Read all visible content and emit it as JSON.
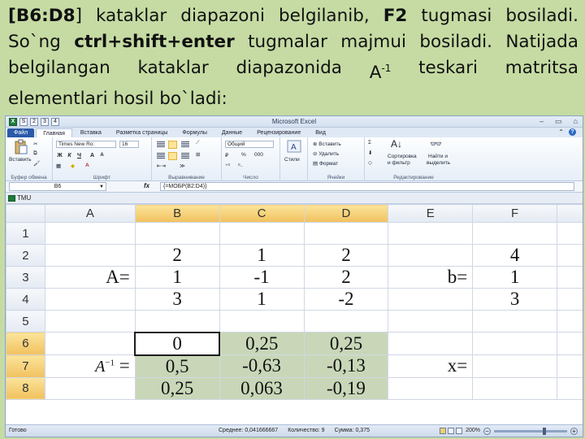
{
  "slide": {
    "line1": {
      "w1": "[B6:D8",
      "w1b": "]",
      "w2": "kataklar",
      "w3": "diapazoni",
      "w4": "belgilanib,",
      "w5": "F2",
      "w6": "tugmasi",
      "w7": "bosiladi."
    },
    "line2": {
      "w1": "So`ng",
      "w2": "ctrl+shift+enter",
      "w3": "tugmalar",
      "w4": "majmui",
      "w5": "bosiladi.",
      "w6": "Natijada"
    },
    "line3": {
      "w1": "belgilangan",
      "w2": "kataklar",
      "w3": "diapazonida",
      "w4a": "A",
      "w4sup": "-1",
      "w5": "teskari",
      "w6": "matritsa"
    },
    "line4": "elementlari hosil bo`ladi:"
  },
  "excel": {
    "title": "Microsoft Excel",
    "qat": [
      "X",
      "S",
      "2",
      "3",
      "4"
    ],
    "window_buttons": [
      "–",
      "▭",
      "⌂"
    ],
    "tabs": [
      {
        "label": "Файл",
        "key": ""
      },
      {
        "label": "Главная",
        "key": "Я"
      },
      {
        "label": "Вставка",
        "key": "С"
      },
      {
        "label": "Разметка страницы",
        "key": "З"
      },
      {
        "label": "Формулы",
        "key": "Л"
      },
      {
        "label": "Данные",
        "key": "Ы"
      },
      {
        "label": "Рецензирование",
        "key": "Р"
      },
      {
        "label": "Вид",
        "key": "О"
      }
    ],
    "ribbon": {
      "clipboard": {
        "paste": "Вставить",
        "label": "Буфер обмена"
      },
      "font": {
        "name": "Times New Ro:",
        "size": "16",
        "bold": "Ж",
        "italic": "К",
        "underline": "Ч",
        "grow": "A",
        "shrink": "A",
        "label": "Шрифт"
      },
      "alignment": {
        "label": "Выравнивание"
      },
      "number": {
        "format": "Общий",
        "percent": "%",
        "thousands": "000",
        "label": "Число"
      },
      "styles": {
        "label": "Стили"
      },
      "cells": {
        "insert": "Вставить",
        "delete": "Удалить",
        "format": "Формат",
        "label": "Ячейки"
      },
      "editing": {
        "sort": "Сортировка",
        "sort2": "и фильтр",
        "find": "Найти и",
        "find2": "выделить",
        "label": "Редактирование"
      }
    },
    "formula_bar": {
      "name_box": "B6",
      "fx": "fx",
      "formula": "{=МОБР(B2:D4)}"
    },
    "workbook_title": "TMU",
    "columns": [
      "A",
      "B",
      "C",
      "D",
      "E",
      "F"
    ],
    "rows": [
      "1",
      "2",
      "3",
      "4",
      "5",
      "6",
      "7",
      "8"
    ],
    "cells": {
      "A3": "A=",
      "B2": "2",
      "C2": "1",
      "D2": "2",
      "B3": "1",
      "C3": "-1",
      "D3": "2",
      "B4": "3",
      "C4": "1",
      "D4": "-2",
      "E3": "b=",
      "F2": "4",
      "F3": "1",
      "F4": "3",
      "A7_base": "A",
      "A7_sup": "−1",
      "A7_eq": " =",
      "B6": "0",
      "C6": "0,25",
      "D6": "0,25",
      "B7": "0,5",
      "C7": "-0,63",
      "D7": "-0,13",
      "B8": "0,25",
      "C8": "0,063",
      "D8": "-0,19",
      "E7": "x="
    },
    "status": {
      "ready": "Готово",
      "average": "Среднее: 0,041666667",
      "count": "Количество: 9",
      "sum": "Сумма: 0,375",
      "zoom": "200%"
    },
    "colors": {
      "selected_header": "#f1c15f",
      "result_fill": "#c9d7b8",
      "slide_bg": "#c5dba3",
      "file_tab": "#2a5aa8"
    }
  }
}
